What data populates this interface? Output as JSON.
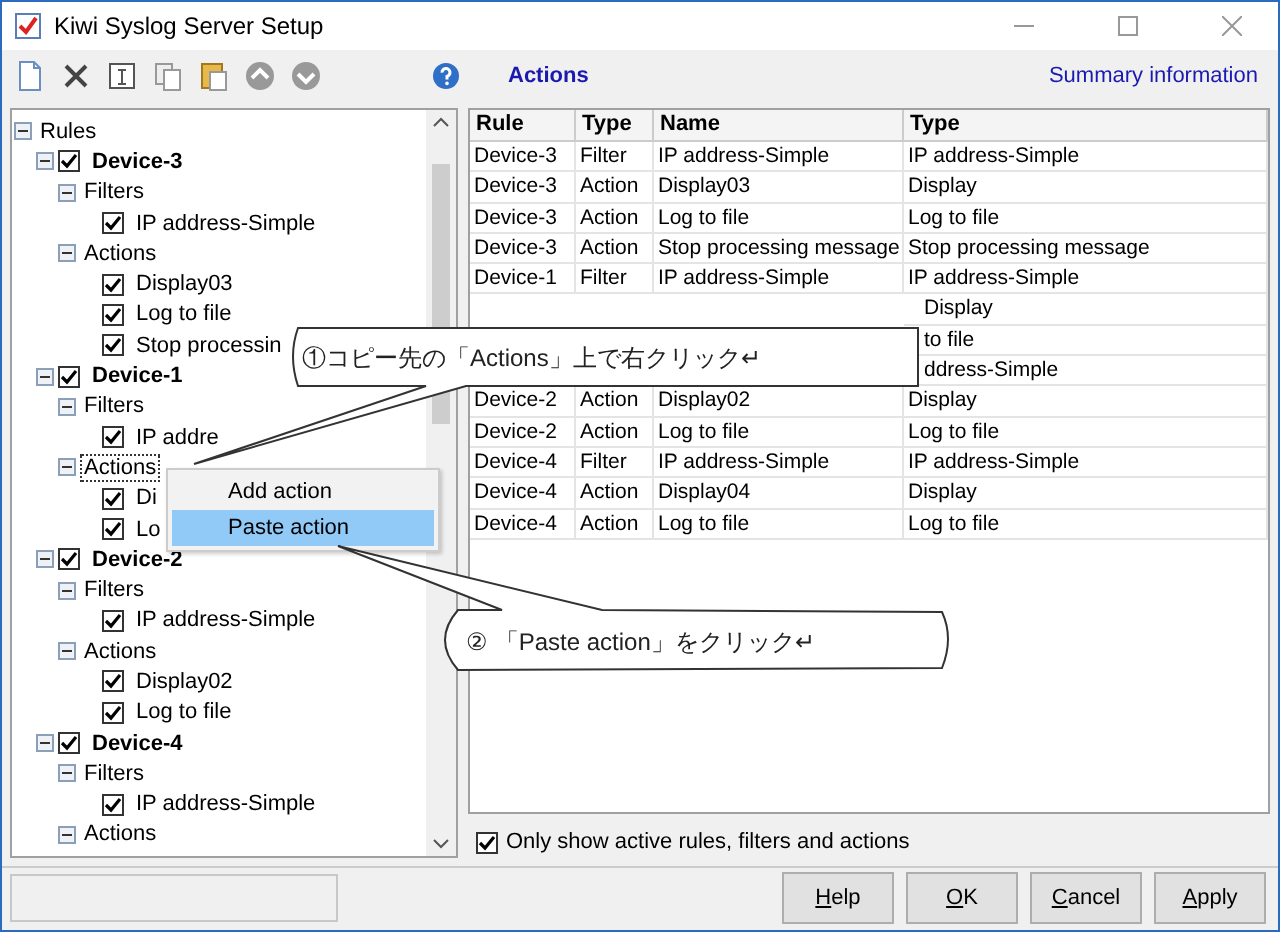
{
  "window": {
    "title": "Kiwi Syslog Server Setup"
  },
  "toolbar": {
    "section_title": "Actions",
    "summary_link": "Summary information"
  },
  "tree": [
    {
      "label": "Rules",
      "kind": "root",
      "expanded": true,
      "selected": false,
      "children": [
        {
          "label": "Device-3",
          "kind": "rule",
          "expanded": true,
          "checked": true,
          "selected": false,
          "children": [
            {
              "label": "Filters",
              "kind": "group",
              "expanded": true,
              "selected": false,
              "children": [
                {
                  "label": "IP address-Simple",
                  "kind": "item",
                  "checked": true,
                  "selected": false
                }
              ]
            },
            {
              "label": "Actions",
              "kind": "group",
              "expanded": true,
              "selected": false,
              "children": [
                {
                  "label": "Display03",
                  "kind": "item",
                  "checked": true,
                  "selected": false
                },
                {
                  "label": "Log to file",
                  "kind": "item",
                  "checked": true,
                  "selected": false
                },
                {
                  "label": "Stop processin",
                  "kind": "item",
                  "checked": true,
                  "selected": false
                }
              ]
            }
          ]
        },
        {
          "label": "Device-1",
          "kind": "rule",
          "expanded": true,
          "checked": true,
          "selected": false,
          "children": [
            {
              "label": "Filters",
              "kind": "group",
              "expanded": true,
              "selected": false,
              "children": [
                {
                  "label": "IP addre",
                  "kind": "item",
                  "checked": true,
                  "selected": false
                }
              ]
            },
            {
              "label": "Actions",
              "kind": "group",
              "expanded": true,
              "selected": true,
              "children": [
                {
                  "label": "Di",
                  "kind": "item",
                  "checked": true,
                  "selected": false
                },
                {
                  "label": "Lo",
                  "kind": "item",
                  "checked": true,
                  "selected": false
                }
              ]
            }
          ]
        },
        {
          "label": "Device-2",
          "kind": "rule",
          "expanded": true,
          "checked": true,
          "selected": false,
          "children": [
            {
              "label": "Filters",
              "kind": "group",
              "expanded": true,
              "selected": false,
              "children": [
                {
                  "label": "IP address-Simple",
                  "kind": "item",
                  "checked": true,
                  "selected": false
                }
              ]
            },
            {
              "label": "Actions",
              "kind": "group",
              "expanded": true,
              "selected": false,
              "children": [
                {
                  "label": "Display02",
                  "kind": "item",
                  "checked": true,
                  "selected": false
                },
                {
                  "label": "Log to file",
                  "kind": "item",
                  "checked": true,
                  "selected": false
                }
              ]
            }
          ]
        },
        {
          "label": "Device-4",
          "kind": "rule",
          "expanded": true,
          "checked": true,
          "selected": false,
          "children": [
            {
              "label": "Filters",
              "kind": "group",
              "expanded": true,
              "selected": false,
              "children": [
                {
                  "label": "IP address-Simple",
                  "kind": "item",
                  "checked": true,
                  "selected": false
                }
              ]
            },
            {
              "label": "Actions",
              "kind": "group",
              "expanded": true,
              "selected": false
            }
          ]
        }
      ]
    }
  ],
  "table": {
    "columns": [
      "Rule",
      "Type",
      "Name",
      "Type"
    ],
    "rows": [
      {
        "rule": "Device-3",
        "type": "Filter",
        "name": "IP address-Simple",
        "type_2": "IP address-Simple"
      },
      {
        "rule": "Device-3",
        "type": "Action",
        "name": "Display03",
        "type_2": "Display"
      },
      {
        "rule": "Device-3",
        "type": "Action",
        "name": "Log to file",
        "type_2": "Log to file"
      },
      {
        "rule": "Device-3",
        "type": "Action",
        "name": "Stop processing message",
        "type_2": "Stop processing message"
      },
      {
        "rule": "Device-1",
        "type": "Filter",
        "name": "IP address-Simple",
        "type_2": "IP address-Simple"
      },
      {
        "type_2": "Display"
      },
      {
        "type_2": "to file"
      },
      {
        "type_2": "ddress-Simple"
      },
      {
        "rule": "Device-2",
        "type": "Action",
        "name": "Display02",
        "type_2": "Display"
      },
      {
        "rule": "Device-2",
        "type": "Action",
        "name": "Log to file",
        "type_2": "Log to file"
      },
      {
        "rule": "Device-4",
        "type": "Filter",
        "name": "IP address-Simple",
        "type_2": "IP address-Simple"
      },
      {
        "rule": "Device-4",
        "type": "Action",
        "name": "Display04",
        "type_2": "Display"
      },
      {
        "rule": "Device-4",
        "type": "Action",
        "name": "Log to file",
        "type_2": "Log to file"
      }
    ]
  },
  "active_only": {
    "label": "Only show active rules, filters and actions",
    "checked": true
  },
  "buttons": [
    "Help",
    "OK",
    "Cancel",
    "Apply"
  ],
  "context_menu": [
    {
      "label": "Add action",
      "selected": false
    },
    {
      "label": "Paste action",
      "selected": true
    }
  ],
  "callouts": [
    "①コピー先の「Actions」上で右クリック↵",
    "② 「Paste action」をクリック↵"
  ]
}
